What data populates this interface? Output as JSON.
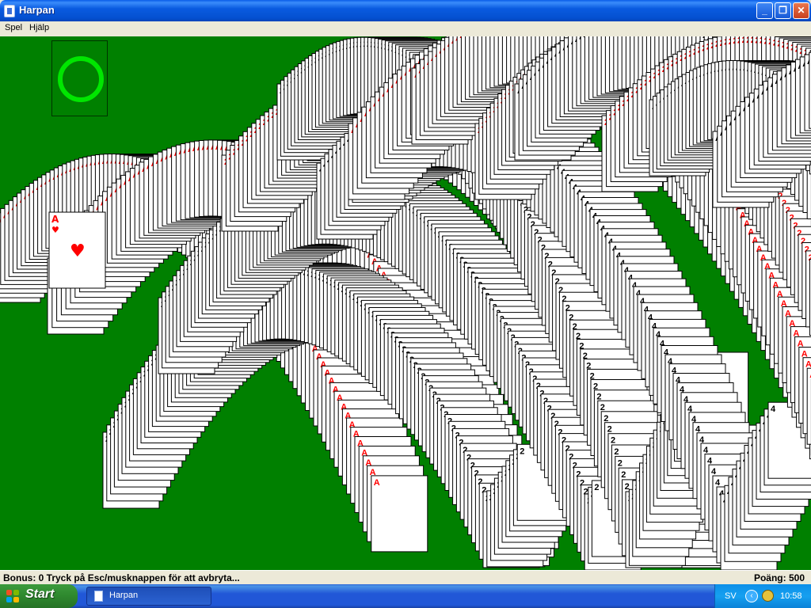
{
  "window": {
    "title": "Harpan",
    "minimize_label": "_",
    "maximize_label": "❐",
    "close_label": "✕"
  },
  "menu": {
    "items": [
      {
        "label": "Spel"
      },
      {
        "label": "Hjälp"
      }
    ]
  },
  "status": {
    "left": "Bonus: 0  Tryck på Esc/musknappen för att avbryta...",
    "right": "Poäng: 500"
  },
  "taskbar": {
    "start_label": "Start",
    "task_label": "Harpan",
    "lang": "SV",
    "time": "10:58"
  },
  "foundation": {
    "completed_stacks": 1,
    "ring_color": "#00e600"
  },
  "cascade_top_card": {
    "rank": "A",
    "suit": "hearts",
    "suit_glyph": "♥"
  },
  "colors": {
    "felt": "#008000",
    "red_suit": "#ff0000",
    "black_suit": "#000000"
  }
}
